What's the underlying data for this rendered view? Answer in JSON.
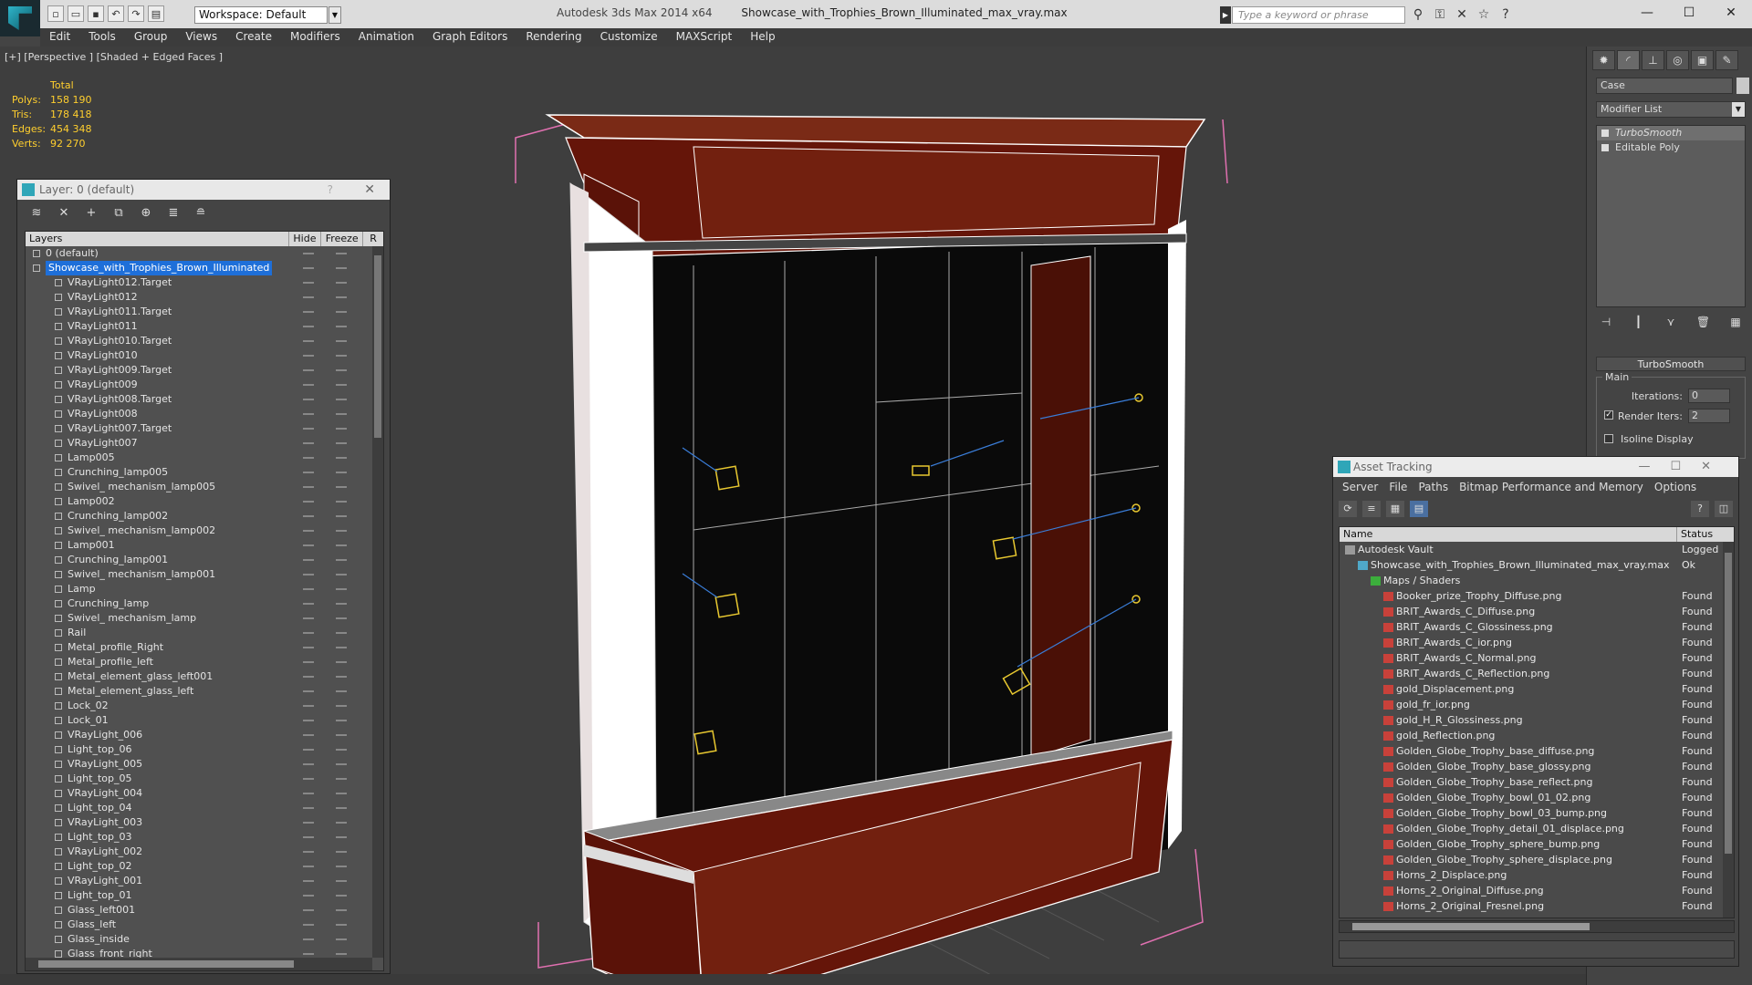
{
  "app": {
    "title": "Autodesk 3ds Max  2014 x64",
    "file": "Showcase_with_Trophies_Brown_Illuminated_max_vray.max",
    "workspace": "Workspace: Default",
    "search_placeholder": "Type a keyword or phrase"
  },
  "menu": [
    "Edit",
    "Tools",
    "Group",
    "Views",
    "Create",
    "Modifiers",
    "Animation",
    "Graph Editors",
    "Rendering",
    "Customize",
    "MAXScript",
    "Help"
  ],
  "viewport": {
    "label": "[+] [Perspective ] [Shaded + Edged Faces ]",
    "stats": {
      "header": "Total",
      "rows": [
        {
          "k": "Polys:",
          "v": "158 190"
        },
        {
          "k": "Tris:",
          "v": "178 418"
        },
        {
          "k": "Edges:",
          "v": "454 348"
        },
        {
          "k": "Verts:",
          "v": "92 270"
        }
      ]
    }
  },
  "layer_window": {
    "title": "Layer: 0 (default)",
    "help": "?",
    "headers": {
      "layers": "Layers",
      "hide": "Hide",
      "freeze": "Freeze",
      "r": "R"
    },
    "rows": [
      {
        "name": "0 (default)",
        "indent": 1
      },
      {
        "name": "Showcase_with_Trophies_Brown_Illuminated",
        "indent": 1,
        "selected": true
      },
      {
        "name": "VRayLight012.Target",
        "indent": 2
      },
      {
        "name": "VRayLight012",
        "indent": 2
      },
      {
        "name": "VRayLight011.Target",
        "indent": 2
      },
      {
        "name": "VRayLight011",
        "indent": 2
      },
      {
        "name": "VRayLight010.Target",
        "indent": 2
      },
      {
        "name": "VRayLight010",
        "indent": 2
      },
      {
        "name": "VRayLight009.Target",
        "indent": 2
      },
      {
        "name": "VRayLight009",
        "indent": 2
      },
      {
        "name": "VRayLight008.Target",
        "indent": 2
      },
      {
        "name": "VRayLight008",
        "indent": 2
      },
      {
        "name": "VRayLight007.Target",
        "indent": 2
      },
      {
        "name": "VRayLight007",
        "indent": 2
      },
      {
        "name": "Lamp005",
        "indent": 2
      },
      {
        "name": "Crunching_lamp005",
        "indent": 2
      },
      {
        "name": "Swivel_ mechanism_lamp005",
        "indent": 2
      },
      {
        "name": "Lamp002",
        "indent": 2
      },
      {
        "name": "Crunching_lamp002",
        "indent": 2
      },
      {
        "name": "Swivel_ mechanism_lamp002",
        "indent": 2
      },
      {
        "name": "Lamp001",
        "indent": 2
      },
      {
        "name": "Crunching_lamp001",
        "indent": 2
      },
      {
        "name": "Swivel_ mechanism_lamp001",
        "indent": 2
      },
      {
        "name": "Lamp",
        "indent": 2
      },
      {
        "name": "Crunching_lamp",
        "indent": 2
      },
      {
        "name": "Swivel_ mechanism_lamp",
        "indent": 2
      },
      {
        "name": "Rail",
        "indent": 2
      },
      {
        "name": "Metal_profile_Right",
        "indent": 2
      },
      {
        "name": "Metal_profile_left",
        "indent": 2
      },
      {
        "name": "Metal_element_glass_left001",
        "indent": 2
      },
      {
        "name": "Metal_element_glass_left",
        "indent": 2
      },
      {
        "name": "Lock_02",
        "indent": 2
      },
      {
        "name": "Lock_01",
        "indent": 2
      },
      {
        "name": "VRayLight_006",
        "indent": 2
      },
      {
        "name": "Light_top_06",
        "indent": 2
      },
      {
        "name": "VRayLight_005",
        "indent": 2
      },
      {
        "name": "Light_top_05",
        "indent": 2
      },
      {
        "name": "VRayLight_004",
        "indent": 2
      },
      {
        "name": "Light_top_04",
        "indent": 2
      },
      {
        "name": "VRayLight_003",
        "indent": 2
      },
      {
        "name": "Light_top_03",
        "indent": 2
      },
      {
        "name": "VRayLight_002",
        "indent": 2
      },
      {
        "name": "Light_top_02",
        "indent": 2
      },
      {
        "name": "VRayLight_001",
        "indent": 2
      },
      {
        "name": "Light_top_01",
        "indent": 2
      },
      {
        "name": "Glass_left001",
        "indent": 2
      },
      {
        "name": "Glass_left",
        "indent": 2
      },
      {
        "name": "Glass_inside",
        "indent": 2
      },
      {
        "name": "Glass_front_right",
        "indent": 2
      }
    ]
  },
  "command_panel": {
    "object_name": "Case",
    "modifier_list": "Modifier List",
    "stack": [
      {
        "label": "TurboSmooth",
        "selected": true
      },
      {
        "label": "Editable Poly",
        "selected": false
      }
    ],
    "rollout": {
      "title": "TurboSmooth",
      "group": "Main",
      "iterations_label": "Iterations:",
      "iterations": "0",
      "render_iters_label": "Render Iters:",
      "render_iters": "2",
      "isoline_label": "Isoline Display"
    }
  },
  "asset_tracking": {
    "title": "Asset Tracking",
    "menu": [
      "Server",
      "File",
      "Paths",
      "Bitmap Performance and Memory",
      "Options"
    ],
    "headers": {
      "name": "Name",
      "status": "Status"
    },
    "rows": [
      {
        "name": "Autodesk Vault",
        "status": "Logged",
        "level": 1
      },
      {
        "name": "Showcase_with_Trophies_Brown_Illuminated_max_vray.max",
        "status": "Ok",
        "level": 2
      },
      {
        "name": "Maps / Shaders",
        "status": "",
        "level": 3
      },
      {
        "name": "Booker_prize_Trophy_Diffuse.png",
        "status": "Found",
        "level": 4
      },
      {
        "name": "BRIT_Awards_C_Diffuse.png",
        "status": "Found",
        "level": 4
      },
      {
        "name": "BRIT_Awards_C_Glossiness.png",
        "status": "Found",
        "level": 4
      },
      {
        "name": "BRIT_Awards_C_ior.png",
        "status": "Found",
        "level": 4
      },
      {
        "name": "BRIT_Awards_C_Normal.png",
        "status": "Found",
        "level": 4
      },
      {
        "name": "BRIT_Awards_C_Reflection.png",
        "status": "Found",
        "level": 4
      },
      {
        "name": "gold_Displacement.png",
        "status": "Found",
        "level": 4
      },
      {
        "name": "gold_fr_ior.png",
        "status": "Found",
        "level": 4
      },
      {
        "name": "gold_H_R_Glossiness.png",
        "status": "Found",
        "level": 4
      },
      {
        "name": "gold_Reflection.png",
        "status": "Found",
        "level": 4
      },
      {
        "name": "Golden_Globe_Trophy_base_diffuse.png",
        "status": "Found",
        "level": 4
      },
      {
        "name": "Golden_Globe_Trophy_base_glossy.png",
        "status": "Found",
        "level": 4
      },
      {
        "name": "Golden_Globe_Trophy_base_reflect.png",
        "status": "Found",
        "level": 4
      },
      {
        "name": "Golden_Globe_Trophy_bowl_01_02.png",
        "status": "Found",
        "level": 4
      },
      {
        "name": "Golden_Globe_Trophy_bowl_03_bump.png",
        "status": "Found",
        "level": 4
      },
      {
        "name": "Golden_Globe_Trophy_detail_01_displace.png",
        "status": "Found",
        "level": 4
      },
      {
        "name": "Golden_Globe_Trophy_sphere_bump.png",
        "status": "Found",
        "level": 4
      },
      {
        "name": "Golden_Globe_Trophy_sphere_displace.png",
        "status": "Found",
        "level": 4
      },
      {
        "name": "Horns_2_Displace.png",
        "status": "Found",
        "level": 4
      },
      {
        "name": "Horns_2_Original_Diffuse.png",
        "status": "Found",
        "level": 4
      },
      {
        "name": "Horns_2_Original_Fresnel.png",
        "status": "Found",
        "level": 4
      }
    ]
  },
  "colors": {
    "accent": "#1e6fd9",
    "stats": "#ffcf2e",
    "wood": "#6b1a0c",
    "wire": "#ffffff",
    "light_helper": "#e8c830",
    "selection_box": "#e070b0"
  }
}
